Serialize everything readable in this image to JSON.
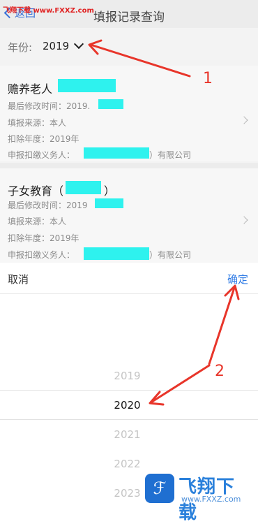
{
  "watermark_top": "飞翔下载 www.FXXZ.com",
  "nav": {
    "back_label": "返回",
    "title": "填报记录查询"
  },
  "filter": {
    "year_label": "年份:",
    "year_value": "2019"
  },
  "records": [
    {
      "title": "赡养老人",
      "modified": "最后修改时间：2019.",
      "source": "填报来源：本人",
      "deduction_year": "扣除年度：2019年",
      "withholder": "申报扣缴义务人：",
      "withholder_suffix": "）有限公司"
    },
    {
      "title": "子女教育（",
      "title_suffix": "）",
      "modified": "最后修改时间：2019",
      "source": "填报来源：本人",
      "deduction_year": "扣除年度：2019年",
      "withholder": "申报扣缴义务人：",
      "withholder_suffix": "）有限公司"
    }
  ],
  "picker": {
    "cancel": "取消",
    "confirm": "确定",
    "options": [
      "2019",
      "2020",
      "2021",
      "2022",
      "2023"
    ],
    "selected": "2020"
  },
  "annotations": {
    "step1": "1",
    "step2": "2",
    "color": "#e8352a"
  },
  "logo": {
    "text": "飞翔下载",
    "url": "www.FXXZ.com",
    "brand_color": "#2a80db"
  },
  "colors": {
    "accent": "#2f7be5",
    "redact": "#2ef2ee"
  }
}
